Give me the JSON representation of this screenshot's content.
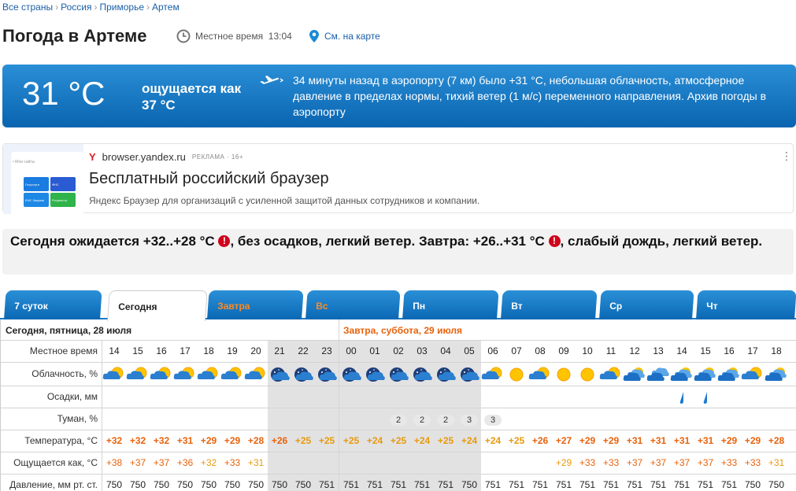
{
  "breadcrumb": [
    "Все страны",
    "Россия",
    "Приморье",
    "Артем"
  ],
  "title": "Погода в Артеме",
  "local_time_label": "Местное время",
  "local_time": "13:04",
  "map_link": "См. на карте",
  "now": {
    "temp": "31 °C",
    "feels": "ощущается как 37 °C",
    "observation": "34 минуты назад в аэропорту (7 км) было +31 °C, небольшая облачность, атмосферное давление в пределах нормы, тихий ветер (1 м/с) переменного направления. Архив погоды в аэропорту"
  },
  "ad": {
    "domain": "browser.yandex.ru",
    "tag": "РЕКЛАМА · 16+",
    "headline": "Бесплатный российский браузер",
    "text": "Яндекс Браузер для организаций с усиленной защитой данных сотрудников и компании.",
    "thumb_tiles": [
      "Госуслуги",
      "ФНС",
      "ЕНС Закупки",
      "Росреестр"
    ]
  },
  "summary": {
    "part1": "Сегодня ожидается +32..+28 °C",
    "part2": ", без осадков, легкий ветер. Завтра: +26..+31 °C",
    "part3": ", слабый дождь, легкий ветер."
  },
  "tabs": [
    {
      "label": "7 суток",
      "weekend": false,
      "active": false
    },
    {
      "label": "Сегодня",
      "weekend": false,
      "active": true
    },
    {
      "label": "Завтра",
      "weekend": true,
      "active": false
    },
    {
      "label": "Вс",
      "weekend": true,
      "active": false
    },
    {
      "label": "Пн",
      "weekend": false,
      "active": false
    },
    {
      "label": "Вт",
      "weekend": false,
      "active": false
    },
    {
      "label": "Ср",
      "weekend": false,
      "active": false
    },
    {
      "label": "Чт",
      "weekend": false,
      "active": false
    }
  ],
  "help": "?",
  "days": [
    {
      "label": "Сегодня, пятница, 28 июля",
      "color": "#222222"
    },
    {
      "label": "Завтра, суббота, 29 июля",
      "color": "#e8620c"
    }
  ],
  "row_labels": {
    "time": "Местное время",
    "cloud": "Облачность, %",
    "precip": "Осадки, мм",
    "fog": "Туман, %",
    "temp": "Температура, °C",
    "feels": "Ощущается как, °C",
    "pressure": "Давление, мм рт. ст."
  },
  "hours": [
    "14",
    "15",
    "16",
    "17",
    "18",
    "19",
    "20",
    "21",
    "22",
    "23",
    "00",
    "01",
    "02",
    "03",
    "04",
    "05",
    "06",
    "07",
    "08",
    "09",
    "10",
    "11",
    "12",
    "13",
    "14",
    "15",
    "16",
    "17",
    "18"
  ],
  "night": [
    false,
    false,
    false,
    false,
    false,
    false,
    false,
    true,
    true,
    true,
    true,
    true,
    true,
    true,
    true,
    true,
    false,
    false,
    false,
    false,
    false,
    false,
    false,
    false,
    false,
    false,
    false,
    false,
    false
  ],
  "cloud_icons": [
    "sun-cloud",
    "sun-cloud",
    "sun-cloud",
    "sun-cloud",
    "sun-cloud",
    "sun-cloud",
    "sun-cloud",
    "moon-cloud",
    "moon-cloud",
    "moon-cloud",
    "moon-cloud",
    "moon-cloud",
    "moon-cloud",
    "moon-cloud",
    "moon-cloud",
    "moon-cloud",
    "sun-cloud",
    "sun",
    "sun-cloud",
    "sun",
    "sun",
    "sun-cloud",
    "sun-clouds",
    "clouds",
    "sun-clouds",
    "sun-clouds",
    "sun-clouds",
    "sun-cloud",
    "sun-clouds"
  ],
  "precip": [
    false,
    false,
    false,
    false,
    false,
    false,
    false,
    false,
    false,
    false,
    false,
    false,
    false,
    false,
    false,
    false,
    false,
    false,
    false,
    false,
    false,
    false,
    false,
    false,
    true,
    true,
    false,
    false,
    false
  ],
  "fog": [
    "",
    "",
    "",
    "",
    "",
    "",
    "",
    "",
    "",
    "",
    "",
    "",
    "2",
    "2",
    "2",
    "3",
    "3",
    "",
    "",
    "",
    "",
    "",
    "",
    "",
    "",
    "",
    "",
    "",
    ""
  ],
  "temps": [
    "+32",
    "+32",
    "+32",
    "+31",
    "+29",
    "+29",
    "+28",
    "+26",
    "+25",
    "+25",
    "+25",
    "+24",
    "+25",
    "+24",
    "+25",
    "+24",
    "+24",
    "+25",
    "+26",
    "+27",
    "+29",
    "+29",
    "+31",
    "+31",
    "+31",
    "+31",
    "+29",
    "+29",
    "+28"
  ],
  "feels": [
    "+38",
    "+37",
    "+37",
    "+36",
    "+32",
    "+33",
    "+31",
    "",
    "",
    "",
    "",
    "",
    "",
    "",
    "",
    "",
    "",
    "",
    "",
    "+29",
    "+33",
    "+33",
    "+37",
    "+37",
    "+37",
    "+37",
    "+33",
    "+33",
    "+31"
  ],
  "pressure": [
    "750",
    "750",
    "750",
    "750",
    "750",
    "750",
    "750",
    "750",
    "750",
    "751",
    "751",
    "751",
    "751",
    "751",
    "751",
    "750",
    "751",
    "751",
    "751",
    "751",
    "751",
    "751",
    "751",
    "751",
    "751",
    "751",
    "751",
    "750",
    "750"
  ],
  "colors": {
    "hot": "#e8620c",
    "warm": "#e89a0c",
    "accent": "#1a5fa8"
  }
}
